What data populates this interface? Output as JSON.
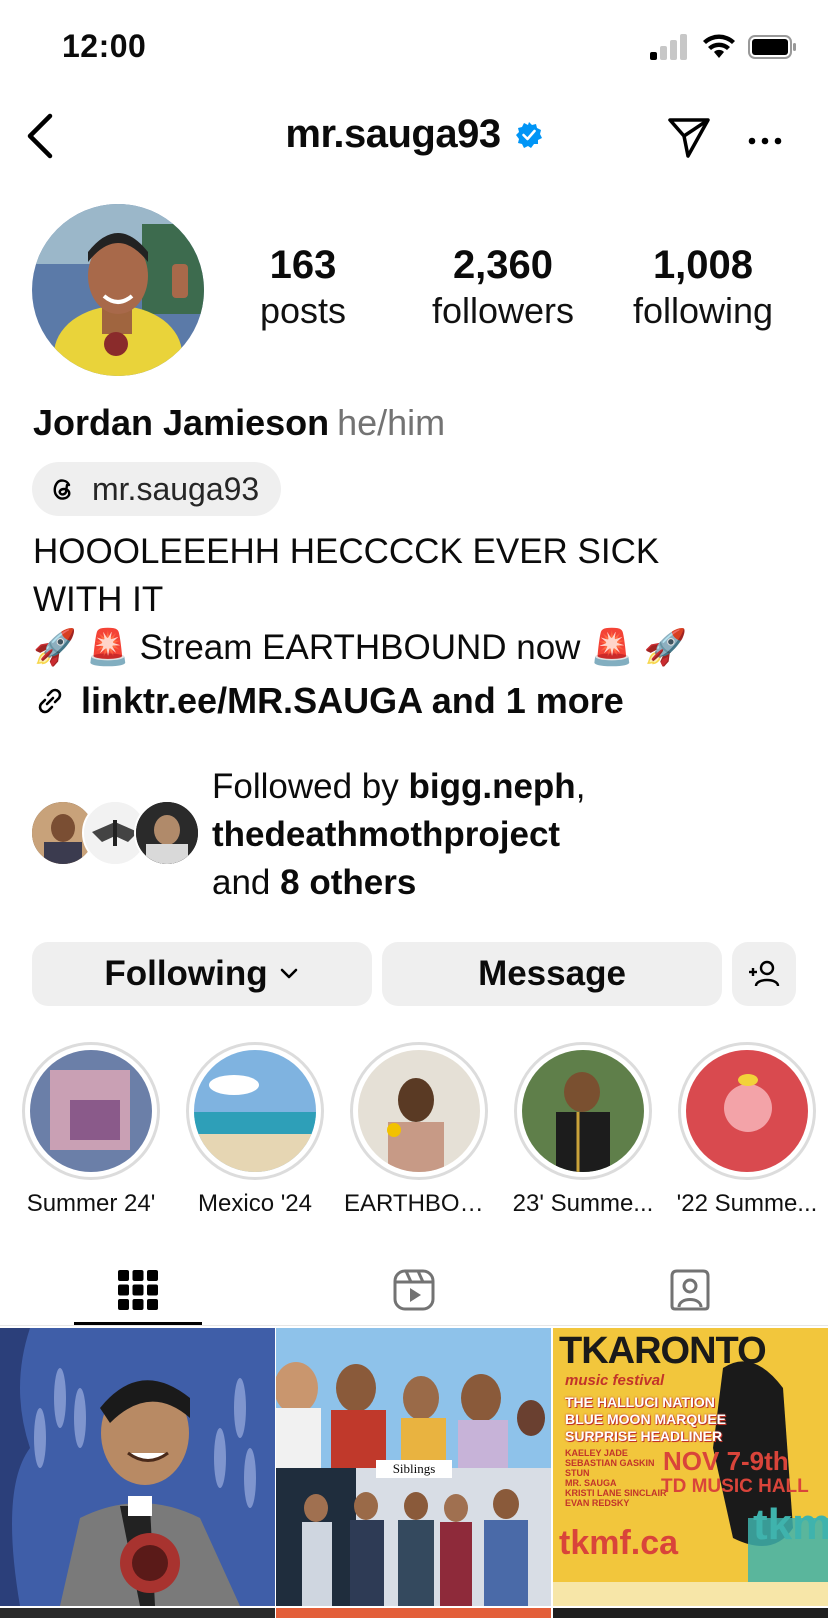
{
  "status_bar": {
    "time": "12:00"
  },
  "header": {
    "username": "mr.sauga93",
    "verified": true
  },
  "profile": {
    "stats": [
      {
        "value": "163",
        "label": "posts"
      },
      {
        "value": "2,360",
        "label": "followers"
      },
      {
        "value": "1,008",
        "label": "following"
      }
    ],
    "full_name": "Jordan Jamieson",
    "pronouns": "he/him",
    "threads_handle": "mr.sauga93",
    "bio_line1": "HOOOLEEEHH HECCCCK EVER SICK",
    "bio_line2": "WITH IT",
    "bio_line3": "🚀 🚨 Stream EARTHBOUND now 🚨 🚀",
    "link": "linktr.ee/MR.SAUGA and 1 more",
    "followed_by": {
      "prefix": "Followed by ",
      "user1": "bigg.neph",
      "comma": ",",
      "user2": "thedeathmothproject",
      "and": "and ",
      "others": "8 others"
    }
  },
  "actions": {
    "following_label": "Following",
    "message_label": "Message"
  },
  "highlights": [
    {
      "label": "Summer 24'"
    },
    {
      "label": "Mexico '24"
    },
    {
      "label": "EARTHBOU..."
    },
    {
      "label": "23' Summe..."
    },
    {
      "label": "'22 Summe..."
    }
  ],
  "tabs": [
    {
      "icon": "grid-icon",
      "active": true
    },
    {
      "icon": "reels-icon",
      "active": false
    },
    {
      "icon": "tagged-icon",
      "active": false
    }
  ],
  "posts": {
    "tile2_caption": "Siblings",
    "tile3": {
      "title": "TKARONTO",
      "subtitle": "music festival",
      "acts": [
        "THE HALLUCI NATION",
        "BLUE MOON MARQUEE",
        "SURPRISE HEADLINER"
      ],
      "lineup": [
        "KAELEY JADE",
        "SEBASTIAN GASKIN",
        "STUN",
        "MR. SAUGA",
        "KRISTI LANE SINCLAIR",
        "EVAN REDSKY"
      ],
      "date": "NOV 7-9th",
      "venue": "TD MUSIC HALL",
      "site": "tkmf.ca",
      "logo": "tkmf"
    }
  },
  "colors": {
    "verified_blue": "#0095f6",
    "button_bg": "#efefef",
    "muted_text": "#737373"
  }
}
